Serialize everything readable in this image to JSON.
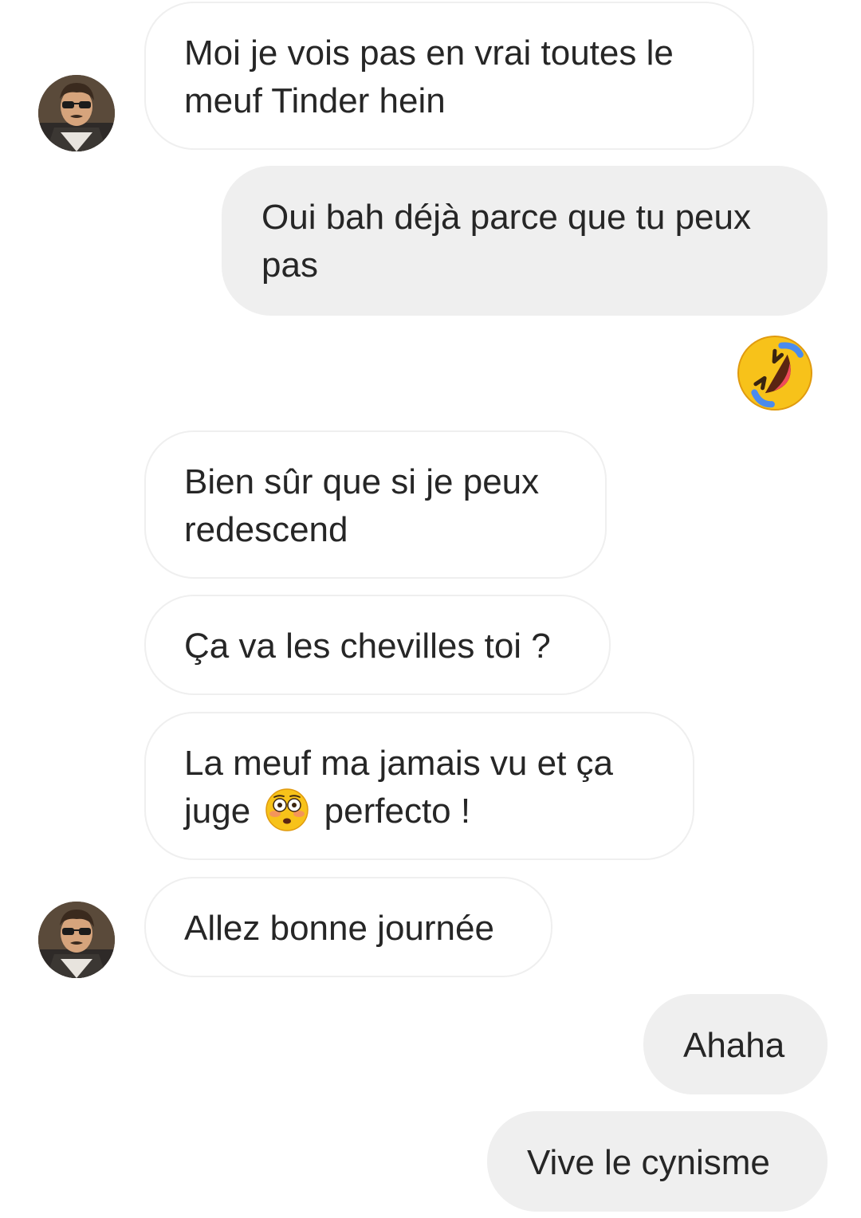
{
  "thread": {
    "messages": [
      {
        "id": "m1",
        "direction": "received",
        "text": "Moi je vois pas en vrai toutes le meuf Tinder hein"
      },
      {
        "id": "m2",
        "direction": "sent",
        "text": "Oui bah déjà parce que tu peux pas"
      },
      {
        "id": "m3",
        "direction": "sent",
        "emoji": "rolling-on-the-floor-laughing-emoji"
      },
      {
        "id": "m4",
        "direction": "received",
        "text": "Bien sûr que si je peux redescend"
      },
      {
        "id": "m5",
        "direction": "received",
        "text": "Ça va les chevilles toi ?"
      },
      {
        "id": "m6",
        "direction": "received",
        "text_before": "La meuf ma jamais vu et ça juge",
        "emoji": "flushed-face-emoji",
        "text_after": "perfecto !"
      },
      {
        "id": "m7",
        "direction": "received",
        "text": "Allez bonne journée"
      },
      {
        "id": "m8",
        "direction": "sent",
        "text": "Ahaha"
      },
      {
        "id": "m9",
        "direction": "sent",
        "text": "Vive le cynisme"
      }
    ]
  },
  "colors": {
    "sent_bubble": "#efefef",
    "received_border": "#efefef",
    "text": "#262626"
  }
}
